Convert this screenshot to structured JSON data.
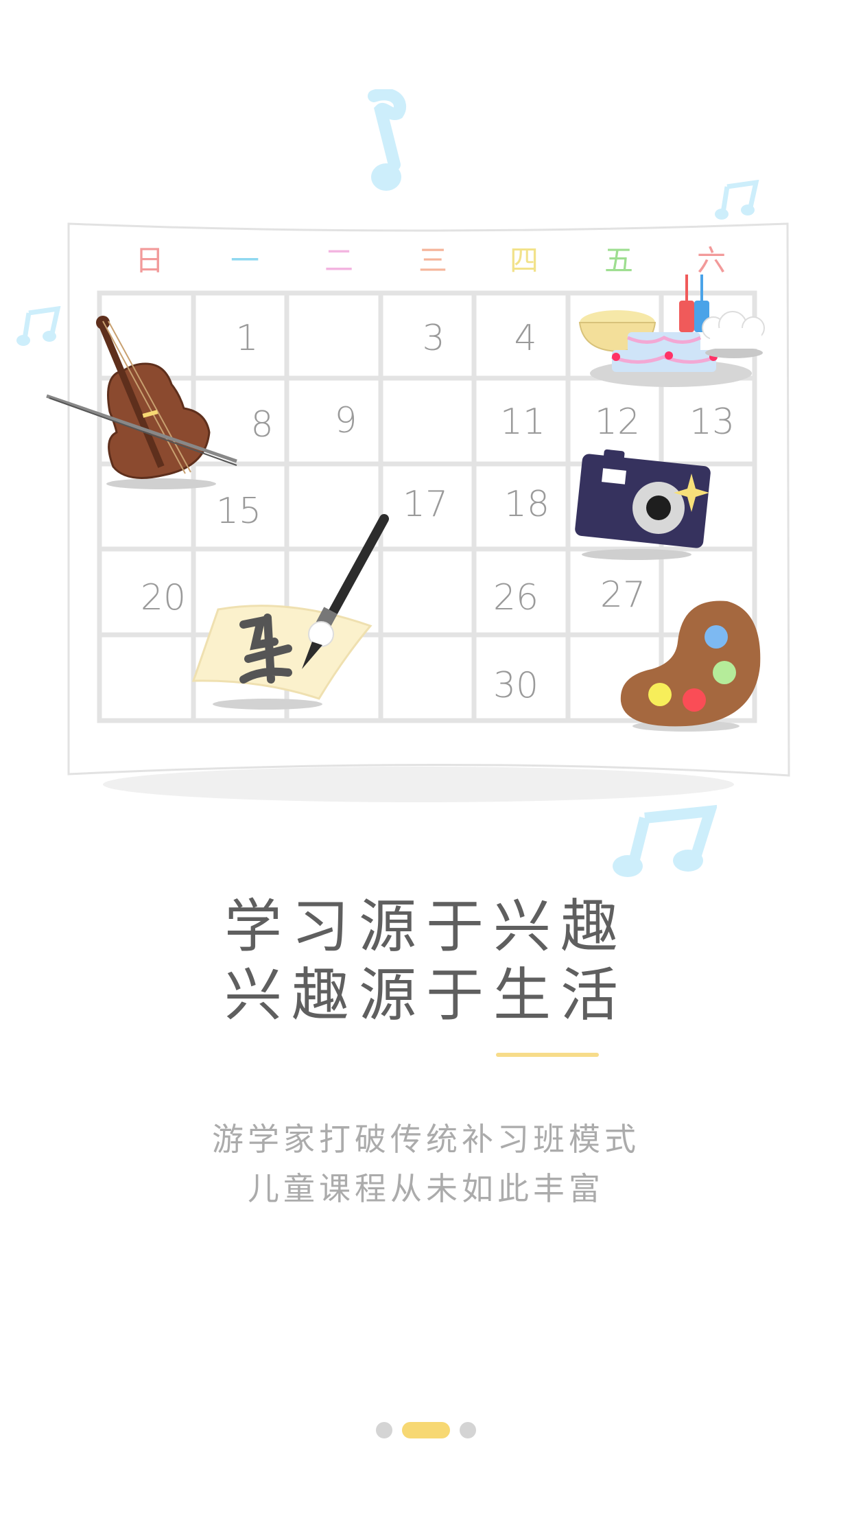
{
  "calendar": {
    "weekdays": [
      {
        "label": "日",
        "color": "#f29a9a"
      },
      {
        "label": "一",
        "color": "#8fd8f0"
      },
      {
        "label": "二",
        "color": "#f3b4e0"
      },
      {
        "label": "三",
        "color": "#f5b49a"
      },
      {
        "label": "四",
        "color": "#f2e28a"
      },
      {
        "label": "五",
        "color": "#9ede90"
      },
      {
        "label": "六",
        "color": "#f29a9a"
      }
    ],
    "days": [
      "1",
      "3",
      "4",
      "8",
      "9",
      "11",
      "12",
      "13",
      "15",
      "17",
      "18",
      "20",
      "26",
      "27",
      "30"
    ]
  },
  "headline": {
    "line1": "学习源于兴趣",
    "line2": "兴趣源于生活"
  },
  "subtext": {
    "line1": "游学家打破传统补习班模式",
    "line2": "儿童课程从未如此丰富"
  },
  "pager": {
    "count": 3,
    "active_index": 1
  },
  "colors": {
    "accent": "#f7dc8a",
    "headline": "#5f5f5f",
    "subtext": "#ababab",
    "note": "#cdeefb"
  }
}
